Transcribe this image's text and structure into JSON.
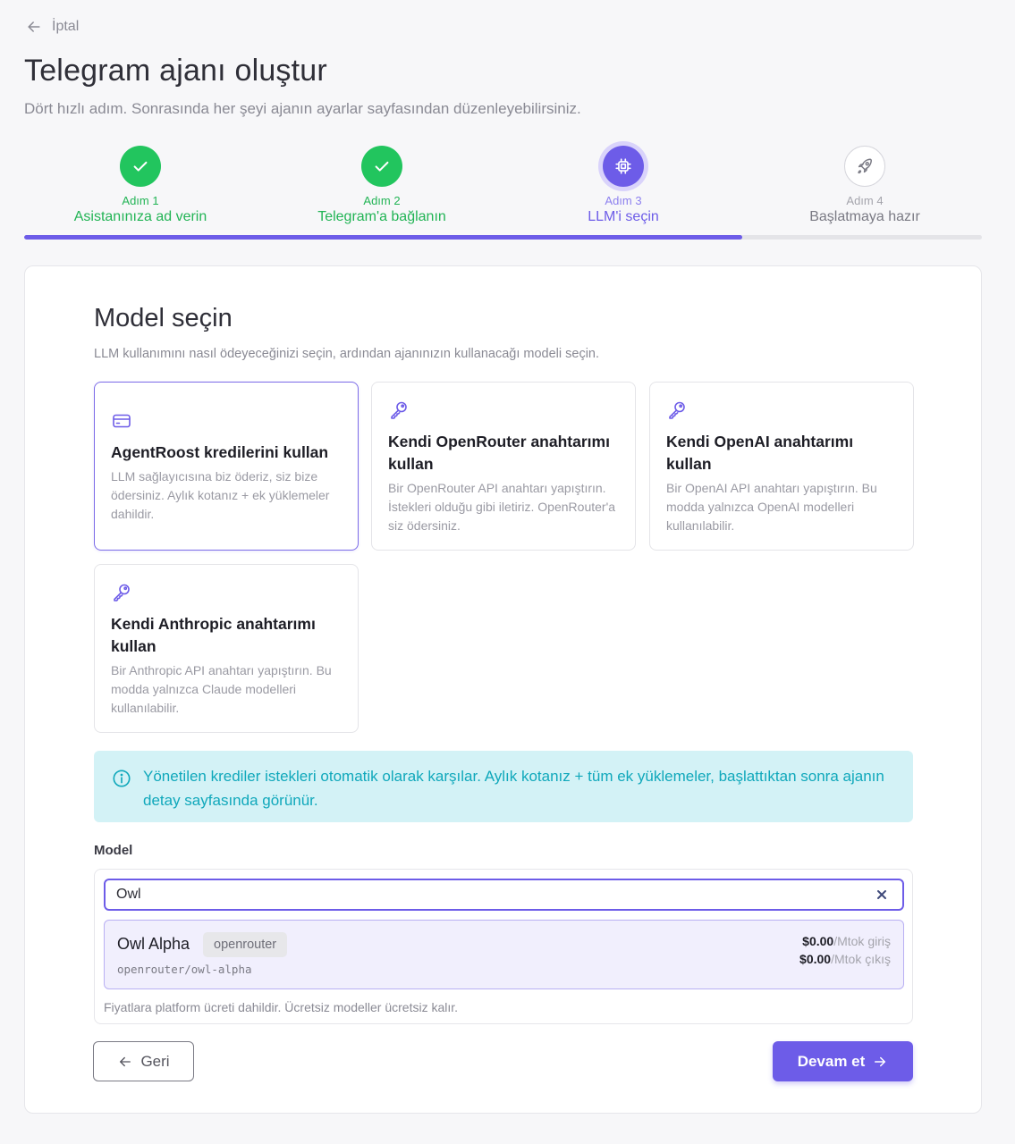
{
  "nav": {
    "cancel_label": "İptal"
  },
  "header": {
    "title": "Telegram ajanı oluştur",
    "subtitle": "Dört hızlı adım. Sonrasında her şeyi ajanın ayarlar sayfasından düzenleyebilirsiniz."
  },
  "stepper": {
    "progress_fraction": 0.75,
    "steps": [
      {
        "number": "Adım 1",
        "title": "Asistanınıza ad verin",
        "state": "done",
        "icon": "check-icon"
      },
      {
        "number": "Adım 2",
        "title": "Telegram'a bağlanın",
        "state": "done",
        "icon": "check-icon"
      },
      {
        "number": "Adım 3",
        "title": "LLM'i seçin",
        "state": "active",
        "icon": "cpu-chip-icon"
      },
      {
        "number": "Adım 4",
        "title": "Başlatmaya hazır",
        "state": "todo",
        "icon": "rocket-icon"
      }
    ]
  },
  "model_section": {
    "title": "Model seçin",
    "description": "LLM kullanımını nasıl ödeyeceğinizi seçin, ardından ajanınızın kullanacağı modeli seçin.",
    "options": [
      {
        "title": "AgentRoost kredilerini kullan",
        "description": "LLM sağlayıcısına biz öderiz, siz bize ödersiniz. Aylık kotanız + ek yüklemeler dahildir.",
        "icon": "credit-card-icon",
        "selected": true
      },
      {
        "title": "Kendi OpenRouter anahtarımı kullan",
        "description": "Bir OpenRouter API anahtarı yapıştırın. İstekleri olduğu gibi iletiriz. OpenRouter'a siz ödersiniz.",
        "icon": "key-icon",
        "selected": false
      },
      {
        "title": "Kendi OpenAI anahtarımı kullan",
        "description": "Bir OpenAI API anahtarı yapıştırın. Bu modda yalnızca OpenAI modelleri kullanılabilir.",
        "icon": "key-icon",
        "selected": false
      },
      {
        "title": "Kendi Anthropic anahtarımı kullan",
        "description": "Bir Anthropic API anahtarı yapıştırın. Bu modda yalnızca Claude modelleri kullanılabilir.",
        "icon": "key-icon",
        "selected": false
      }
    ],
    "info": "Yönetilen krediler istekleri otomatik olarak karşılar. Aylık kotanız + tüm ek yüklemeler, başlattıktan sonra ajanın detay sayfasında görünür.",
    "model_label": "Model",
    "search_value": "Owl",
    "result": {
      "name": "Owl Alpha",
      "provider": "openrouter",
      "id": "openrouter/owl-alpha",
      "input_price": "$0.00",
      "input_unit": "/Mtok giriş",
      "output_price": "$0.00",
      "output_unit": "/Mtok çıkış"
    },
    "note": "Fiyatlara platform ücreti dahildir. Ücretsiz modeller ücretsiz kalır."
  },
  "actions": {
    "back_label": "Geri",
    "next_label": "Devam et"
  },
  "colors": {
    "accent": "#6d5ce8",
    "success": "#22c55e",
    "info_bg": "#d3f2f6",
    "info_text": "#10a8bb"
  }
}
